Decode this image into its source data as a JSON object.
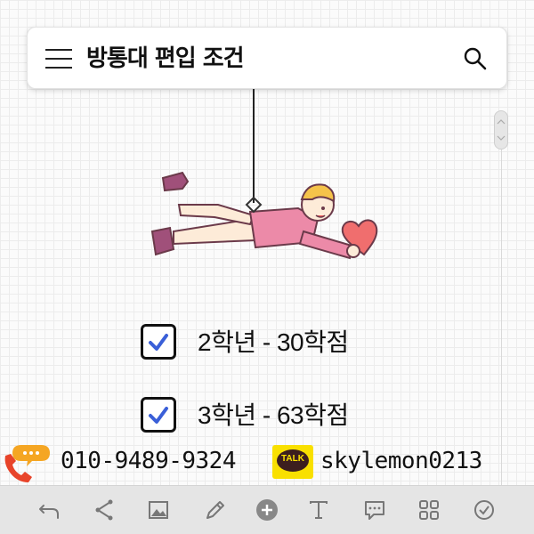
{
  "header": {
    "title": "방통대 편입 조건",
    "menu_icon": "hamburger-menu-icon",
    "search_icon": "search-icon"
  },
  "illustration": {
    "description_icon": "flying-person-holding-heart-illustration"
  },
  "checklist": [
    {
      "checked": true,
      "label": "2학년 - 30학점"
    },
    {
      "checked": true,
      "label": "3학년 - 63학점"
    }
  ],
  "contact": {
    "phone": "010-9489-9324",
    "kakao_badge": "TALK",
    "kakao_id": "skylemon0213"
  },
  "toolbar": {
    "items": [
      "undo-icon",
      "share-icon",
      "image-icon",
      "pencil-icon",
      "add-icon",
      "text-icon",
      "comment-icon",
      "grid-icon",
      "check-circle-icon"
    ]
  },
  "colors": {
    "check_accent": "#3a5fd8",
    "kakao_yellow": "#f9e000",
    "phone_red": "#e8442a",
    "bubble_orange": "#f5a623"
  }
}
